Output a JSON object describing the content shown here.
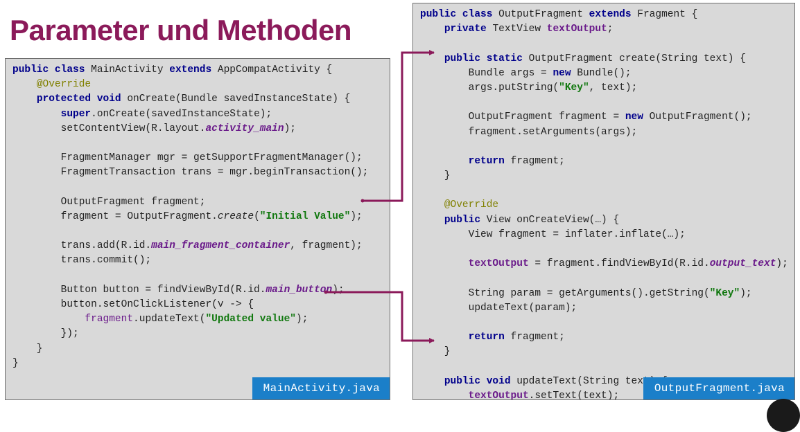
{
  "title": "Parameter und Methoden",
  "left": {
    "filename": "MainActivity.java",
    "lines": [
      [
        [
          "kw",
          "public class"
        ],
        [
          "",
          "MainActivity "
        ],
        [
          "kw",
          "extends"
        ],
        [
          "",
          "AppCompatActivity {"
        ]
      ],
      [
        [
          "",
          "    "
        ],
        [
          "an",
          "@Override"
        ]
      ],
      [
        [
          "",
          "    "
        ],
        [
          "kw",
          "protected void"
        ],
        [
          "",
          "onCreate(Bundle savedInstanceState) {"
        ]
      ],
      [
        [
          "",
          "        "
        ],
        [
          "kw",
          "super"
        ],
        [
          "",
          ".onCreate(savedInstanceState);"
        ]
      ],
      [
        [
          "",
          "        setContentView(R.layout."
        ],
        [
          "sfld",
          "activity_main"
        ],
        [
          "",
          ");"
        ]
      ],
      [
        [
          "",
          ""
        ]
      ],
      [
        [
          "",
          "        FragmentManager mgr = getSupportFragmentManager();"
        ]
      ],
      [
        [
          "",
          "        FragmentTransaction trans = mgr.beginTransaction();"
        ]
      ],
      [
        [
          "",
          ""
        ]
      ],
      [
        [
          "",
          "        OutputFragment fragment;"
        ]
      ],
      [
        [
          "",
          "        fragment = OutputFragment."
        ],
        [
          "it",
          "create"
        ],
        [
          "",
          "("
        ],
        [
          "st",
          "\"Initial Value\""
        ],
        [
          "",
          ");"
        ]
      ],
      [
        [
          "",
          ""
        ]
      ],
      [
        [
          "",
          "        trans.add(R.id."
        ],
        [
          "sfld",
          "main_fragment_container"
        ],
        [
          "",
          ", fragment);"
        ]
      ],
      [
        [
          "",
          "        trans.commit();"
        ]
      ],
      [
        [
          "",
          ""
        ]
      ],
      [
        [
          "",
          "        Button button = findViewById(R.id."
        ],
        [
          "sfld",
          "main_button"
        ],
        [
          "",
          ");"
        ]
      ],
      [
        [
          "",
          "        button.setOnClickListener(v -> {"
        ]
      ],
      [
        [
          "",
          "            "
        ],
        [
          "var",
          "fragment"
        ],
        [
          "",
          ".updateText("
        ],
        [
          "st",
          "\"Updated value\""
        ],
        [
          "",
          ");"
        ]
      ],
      [
        [
          "",
          "        });"
        ]
      ],
      [
        [
          "",
          "    }"
        ]
      ],
      [
        [
          "",
          "}"
        ]
      ]
    ]
  },
  "right": {
    "filename": "OutputFragment.java",
    "lines": [
      [
        [
          "kw",
          "public class"
        ],
        [
          "",
          "OutputFragment "
        ],
        [
          "kw",
          "extends"
        ],
        [
          "",
          "Fragment {"
        ]
      ],
      [
        [
          "",
          "    "
        ],
        [
          "kw",
          "private"
        ],
        [
          "",
          "TextView "
        ],
        [
          "fld",
          "textOutput"
        ],
        [
          "",
          ";"
        ]
      ],
      [
        [
          "",
          ""
        ]
      ],
      [
        [
          "",
          "    "
        ],
        [
          "kw",
          "public static"
        ],
        [
          "",
          "OutputFragment create(String text) {"
        ]
      ],
      [
        [
          "",
          "        Bundle args = "
        ],
        [
          "kw",
          "new"
        ],
        [
          "",
          "Bundle();"
        ]
      ],
      [
        [
          "",
          "        args.putString("
        ],
        [
          "st",
          "\"Key\""
        ],
        [
          "",
          ", text);"
        ]
      ],
      [
        [
          "",
          ""
        ]
      ],
      [
        [
          "",
          "        OutputFragment fragment = "
        ],
        [
          "kw",
          "new"
        ],
        [
          "",
          "OutputFragment();"
        ]
      ],
      [
        [
          "",
          "        fragment.setArguments(args);"
        ]
      ],
      [
        [
          "",
          ""
        ]
      ],
      [
        [
          "",
          "        "
        ],
        [
          "kw",
          "return"
        ],
        [
          "",
          "fragment;"
        ]
      ],
      [
        [
          "",
          "    }"
        ]
      ],
      [
        [
          "",
          ""
        ]
      ],
      [
        [
          "",
          "    "
        ],
        [
          "an",
          "@Override"
        ]
      ],
      [
        [
          "",
          "    "
        ],
        [
          "kw",
          "public"
        ],
        [
          "",
          "View onCreateView(…) {"
        ]
      ],
      [
        [
          "",
          "        View fragment = inflater.inflate(…);"
        ]
      ],
      [
        [
          "",
          ""
        ]
      ],
      [
        [
          "",
          "        "
        ],
        [
          "fld",
          "textOutput"
        ],
        [
          "",
          " = fragment.findViewById(R.id."
        ],
        [
          "sfld",
          "output_text"
        ],
        [
          "",
          ");"
        ]
      ],
      [
        [
          "",
          ""
        ]
      ],
      [
        [
          "",
          "        String param = getArguments().getString("
        ],
        [
          "st",
          "\"Key\""
        ],
        [
          "",
          ");"
        ]
      ],
      [
        [
          "",
          "        updateText(param);"
        ]
      ],
      [
        [
          "",
          ""
        ]
      ],
      [
        [
          "",
          "        "
        ],
        [
          "kw",
          "return"
        ],
        [
          "",
          "fragment;"
        ]
      ],
      [
        [
          "",
          "    }"
        ]
      ],
      [
        [
          "",
          ""
        ]
      ],
      [
        [
          "",
          "    "
        ],
        [
          "kw",
          "public void"
        ],
        [
          "",
          "updateText(String text) {"
        ]
      ],
      [
        [
          "",
          "        "
        ],
        [
          "fld",
          "textOutput"
        ],
        [
          "",
          ".setText(text);"
        ]
      ],
      [
        [
          "",
          "    }"
        ]
      ],
      [
        [
          "",
          "}"
        ]
      ]
    ]
  },
  "colors": {
    "title": "#8b1a5a",
    "arrow": "#8b1a5a",
    "code_background": "#d9d9d9",
    "file_label_background": "#1b7fc9"
  }
}
